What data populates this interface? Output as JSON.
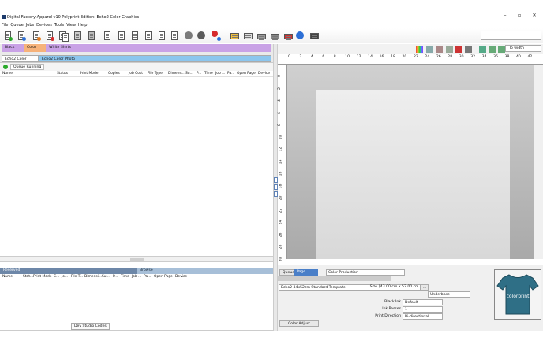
{
  "window": {
    "title": "Digital Factory Apparel v10 Polyprint Edition: Echo2 Color Graphics",
    "minimize": "–",
    "maximize": "▫",
    "close": "✕"
  },
  "menu": [
    "File",
    "Queue",
    "Jobs",
    "Devices",
    "Tools",
    "View",
    "Help"
  ],
  "queue_tabs": [
    {
      "label": "Black Shirts",
      "color": "#c9a2e6"
    },
    {
      "label": "Color Shirts",
      "color": "#f6b27a"
    },
    {
      "label": "White Shirts",
      "color": "#c9a2e6"
    }
  ],
  "sub_tabs": [
    {
      "label": "Echo2 Color Graphics"
    },
    {
      "label": "Echo2 Color Photo"
    }
  ],
  "status": "Queue Running",
  "top_columns": [
    "Name",
    "Status",
    "Print Mode",
    "Copies",
    "Job Cost",
    "File Type",
    "Dimensi...",
    "Su...",
    "P...",
    "Time",
    "Job ...",
    "Pa...",
    "Open Page",
    "Device"
  ],
  "bottom_tabs": {
    "reserved": "Reserved",
    "browse": "Browse"
  },
  "bottom_columns": [
    "Name",
    "Stat...",
    "Print Mode",
    "C...",
    "Jo...",
    "File T...",
    "Dimensi...",
    "Su...",
    "P...",
    "Time",
    "Job ...",
    "Pa...",
    "Open Page",
    "Device"
  ],
  "dev_codes": "Dev Studio Codes",
  "right_toolbar": {
    "zoom": "To width"
  },
  "ruler_x": [
    "0",
    "2",
    "4",
    "6",
    "8",
    "10",
    "12",
    "14",
    "16",
    "18",
    "20",
    "22",
    "24",
    "26",
    "28",
    "30",
    "32",
    "34",
    "36",
    "38",
    "40",
    "42"
  ],
  "ruler_y": [
    "0",
    "2",
    "4",
    "6",
    "8",
    "10",
    "12",
    "14",
    "16",
    "18",
    "20",
    "22",
    "24",
    "26",
    "28",
    "30"
  ],
  "properties": {
    "tabs": [
      "Queue",
      "Page"
    ],
    "production": "Color Production",
    "template": "Echo2 34x52cm Standard Template",
    "size_label": "Size",
    "size_value": "[43.00 cm x 52.00 cm]",
    "size_btn": "...",
    "underbase": "Underbase",
    "black_ink_label": "Black Ink",
    "black_ink_value": "Default",
    "ink_passes_label": "Ink Passes",
    "ink_passes_value": "1",
    "print_direction_label": "Print Direction",
    "print_direction_value": "Bi-directional",
    "color_adjust": "Color Adjust"
  },
  "preview": {
    "shirt_text": "colorprint",
    "shirt_color": "#2f6f86"
  }
}
